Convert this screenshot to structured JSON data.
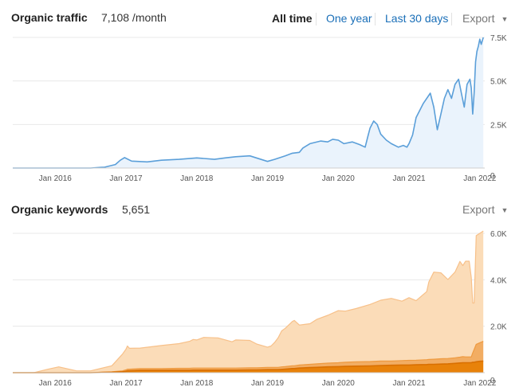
{
  "traffic_header": {
    "title": "Organic traffic",
    "value": "7,108 /month",
    "ranges": [
      "All time",
      "One year",
      "Last 30 days"
    ],
    "active_range": "All time",
    "export_label": "Export"
  },
  "keywords_header": {
    "title": "Organic keywords",
    "value": "5,651",
    "export_label": "Export"
  },
  "colors": {
    "traffic_line": "#5b9fd9",
    "traffic_fill": "#eaf3fc",
    "kw_top3": "#e8820a",
    "kw_4_10": "#f2ad63",
    "kw_11_plus": "#fbdcb8",
    "grid": "#e8e8e8",
    "link": "#1a6fb8"
  },
  "chart_data": [
    {
      "type": "line",
      "title": "Organic traffic",
      "xlabel": "",
      "ylabel": "",
      "x_ticks": [
        "Jan 2016",
        "Jan 2017",
        "Jan 2018",
        "Jan 2019",
        "Jan 2020",
        "Jan 2021",
        "Jan 2022"
      ],
      "y_ticks": [
        "0",
        "2.5K",
        "5.0K",
        "7.5K"
      ],
      "y_tick_values": [
        0,
        2500,
        5000,
        7500
      ],
      "xlim": [
        2015.4,
        2022.07
      ],
      "ylim": [
        0,
        7500
      ],
      "grid": true,
      "legend": "none",
      "series": [
        {
          "x": [
            2015.4,
            2016.0,
            2016.5,
            2016.7,
            2016.85,
            2016.92,
            2016.98,
            2017.08,
            2017.3,
            2017.5,
            2017.75,
            2018.0,
            2018.25,
            2018.4,
            2018.55,
            2018.75,
            2019.0,
            2019.1,
            2019.25,
            2019.35,
            2019.45,
            2019.5,
            2019.6,
            2019.75,
            2019.85,
            2019.92,
            2020.0,
            2020.08,
            2020.2,
            2020.3,
            2020.38,
            2020.42,
            2020.45,
            2020.5,
            2020.55,
            2020.6,
            2020.68,
            2020.75,
            2020.85,
            2020.92,
            2020.97,
            2021.0,
            2021.05,
            2021.1,
            2021.2,
            2021.3,
            2021.35,
            2021.4,
            2021.45,
            2021.5,
            2021.55,
            2021.6,
            2021.65,
            2021.7,
            2021.74,
            2021.78,
            2021.82,
            2021.86,
            2021.88,
            2021.9,
            2021.92,
            2021.94,
            2021.96,
            2021.98,
            2022.0,
            2022.02,
            2022.05
          ],
          "y": [
            0,
            0,
            0,
            50,
            200,
            450,
            600,
            400,
            350,
            450,
            500,
            580,
            500,
            580,
            650,
            700,
            380,
            500,
            700,
            850,
            900,
            1150,
            1400,
            1550,
            1500,
            1650,
            1600,
            1400,
            1500,
            1350,
            1200,
            1850,
            2300,
            2700,
            2500,
            1950,
            1600,
            1400,
            1200,
            1300,
            1200,
            1400,
            1900,
            2900,
            3700,
            4300,
            3500,
            2200,
            3100,
            4000,
            4500,
            4000,
            4800,
            5100,
            4300,
            3500,
            4800,
            5100,
            4600,
            3100,
            4300,
            6100,
            6700,
            7000,
            7400,
            7100,
            7500
          ]
        }
      ]
    },
    {
      "type": "area",
      "title": "Organic keywords",
      "xlabel": "",
      "ylabel": "",
      "x_ticks": [
        "Jan 2016",
        "Jan 2017",
        "Jan 2018",
        "Jan 2019",
        "Jan 2020",
        "Jan 2021",
        "Jan 2022"
      ],
      "y_ticks": [
        "0",
        "2.0K",
        "4.0K",
        "6.0K"
      ],
      "y_tick_values": [
        0,
        2000,
        4000,
        6000
      ],
      "xlim": [
        2015.4,
        2022.07
      ],
      "ylim": [
        0,
        6000
      ],
      "grid": true,
      "legend": "none",
      "stacked": true,
      "x": [
        2015.4,
        2015.7,
        2015.9,
        2016.05,
        2016.3,
        2016.5,
        2016.8,
        2016.95,
        2017.0,
        2017.02,
        2017.05,
        2017.2,
        2017.5,
        2017.75,
        2017.9,
        2017.95,
        2018.0,
        2018.1,
        2018.3,
        2018.5,
        2018.55,
        2018.75,
        2018.85,
        2019.0,
        2019.05,
        2019.1,
        2019.15,
        2019.2,
        2019.25,
        2019.35,
        2019.38,
        2019.45,
        2019.6,
        2019.7,
        2019.85,
        2020.0,
        2020.1,
        2020.25,
        2020.45,
        2020.6,
        2020.75,
        2020.9,
        2021.0,
        2021.1,
        2021.25,
        2021.28,
        2021.35,
        2021.45,
        2021.55,
        2021.65,
        2021.72,
        2021.76,
        2021.8,
        2021.85,
        2021.88,
        2021.9,
        2021.92,
        2021.95,
        2022.0,
        2022.05
      ],
      "series": [
        {
          "name": "",
          "values": [
            0,
            0,
            0,
            0,
            0,
            0,
            20,
            40,
            60,
            80,
            80,
            100,
            100,
            100,
            100,
            110,
            110,
            110,
            110,
            110,
            110,
            120,
            120,
            130,
            130,
            130,
            130,
            140,
            150,
            180,
            180,
            200,
            220,
            230,
            250,
            260,
            270,
            280,
            290,
            310,
            320,
            330,
            330,
            340,
            350,
            360,
            360,
            370,
            380,
            400,
            420,
            430,
            430,
            430,
            430,
            450,
            450,
            470,
            490,
            500
          ]
        },
        {
          "name": "",
          "values": [
            0,
            0,
            0,
            0,
            0,
            0,
            20,
            40,
            60,
            70,
            70,
            80,
            80,
            90,
            90,
            90,
            90,
            90,
            90,
            90,
            90,
            90,
            90,
            100,
            100,
            100,
            100,
            110,
            110,
            120,
            120,
            130,
            140,
            150,
            160,
            170,
            180,
            190,
            190,
            190,
            180,
            190,
            200,
            200,
            210,
            210,
            220,
            230,
            230,
            240,
            250,
            260,
            250,
            250,
            250,
            400,
            550,
            750,
            800,
            850
          ]
        },
        {
          "name": "",
          "values": [
            0,
            0,
            150,
            250,
            80,
            80,
            260,
            720,
            890,
            1000,
            900,
            880,
            990,
            1060,
            1160,
            1230,
            1210,
            1320,
            1300,
            1130,
            1210,
            1180,
            1020,
            870,
            920,
            1070,
            1270,
            1550,
            1650,
            1900,
            1950,
            1720,
            1750,
            1920,
            2060,
            2240,
            2200,
            2290,
            2460,
            2620,
            2700,
            2560,
            2700,
            2560,
            2930,
            3340,
            3750,
            3700,
            3400,
            3690,
            4120,
            3920,
            4120,
            4120,
            3420,
            2150,
            2000,
            4680,
            4710,
            4750
          ]
        }
      ]
    }
  ]
}
